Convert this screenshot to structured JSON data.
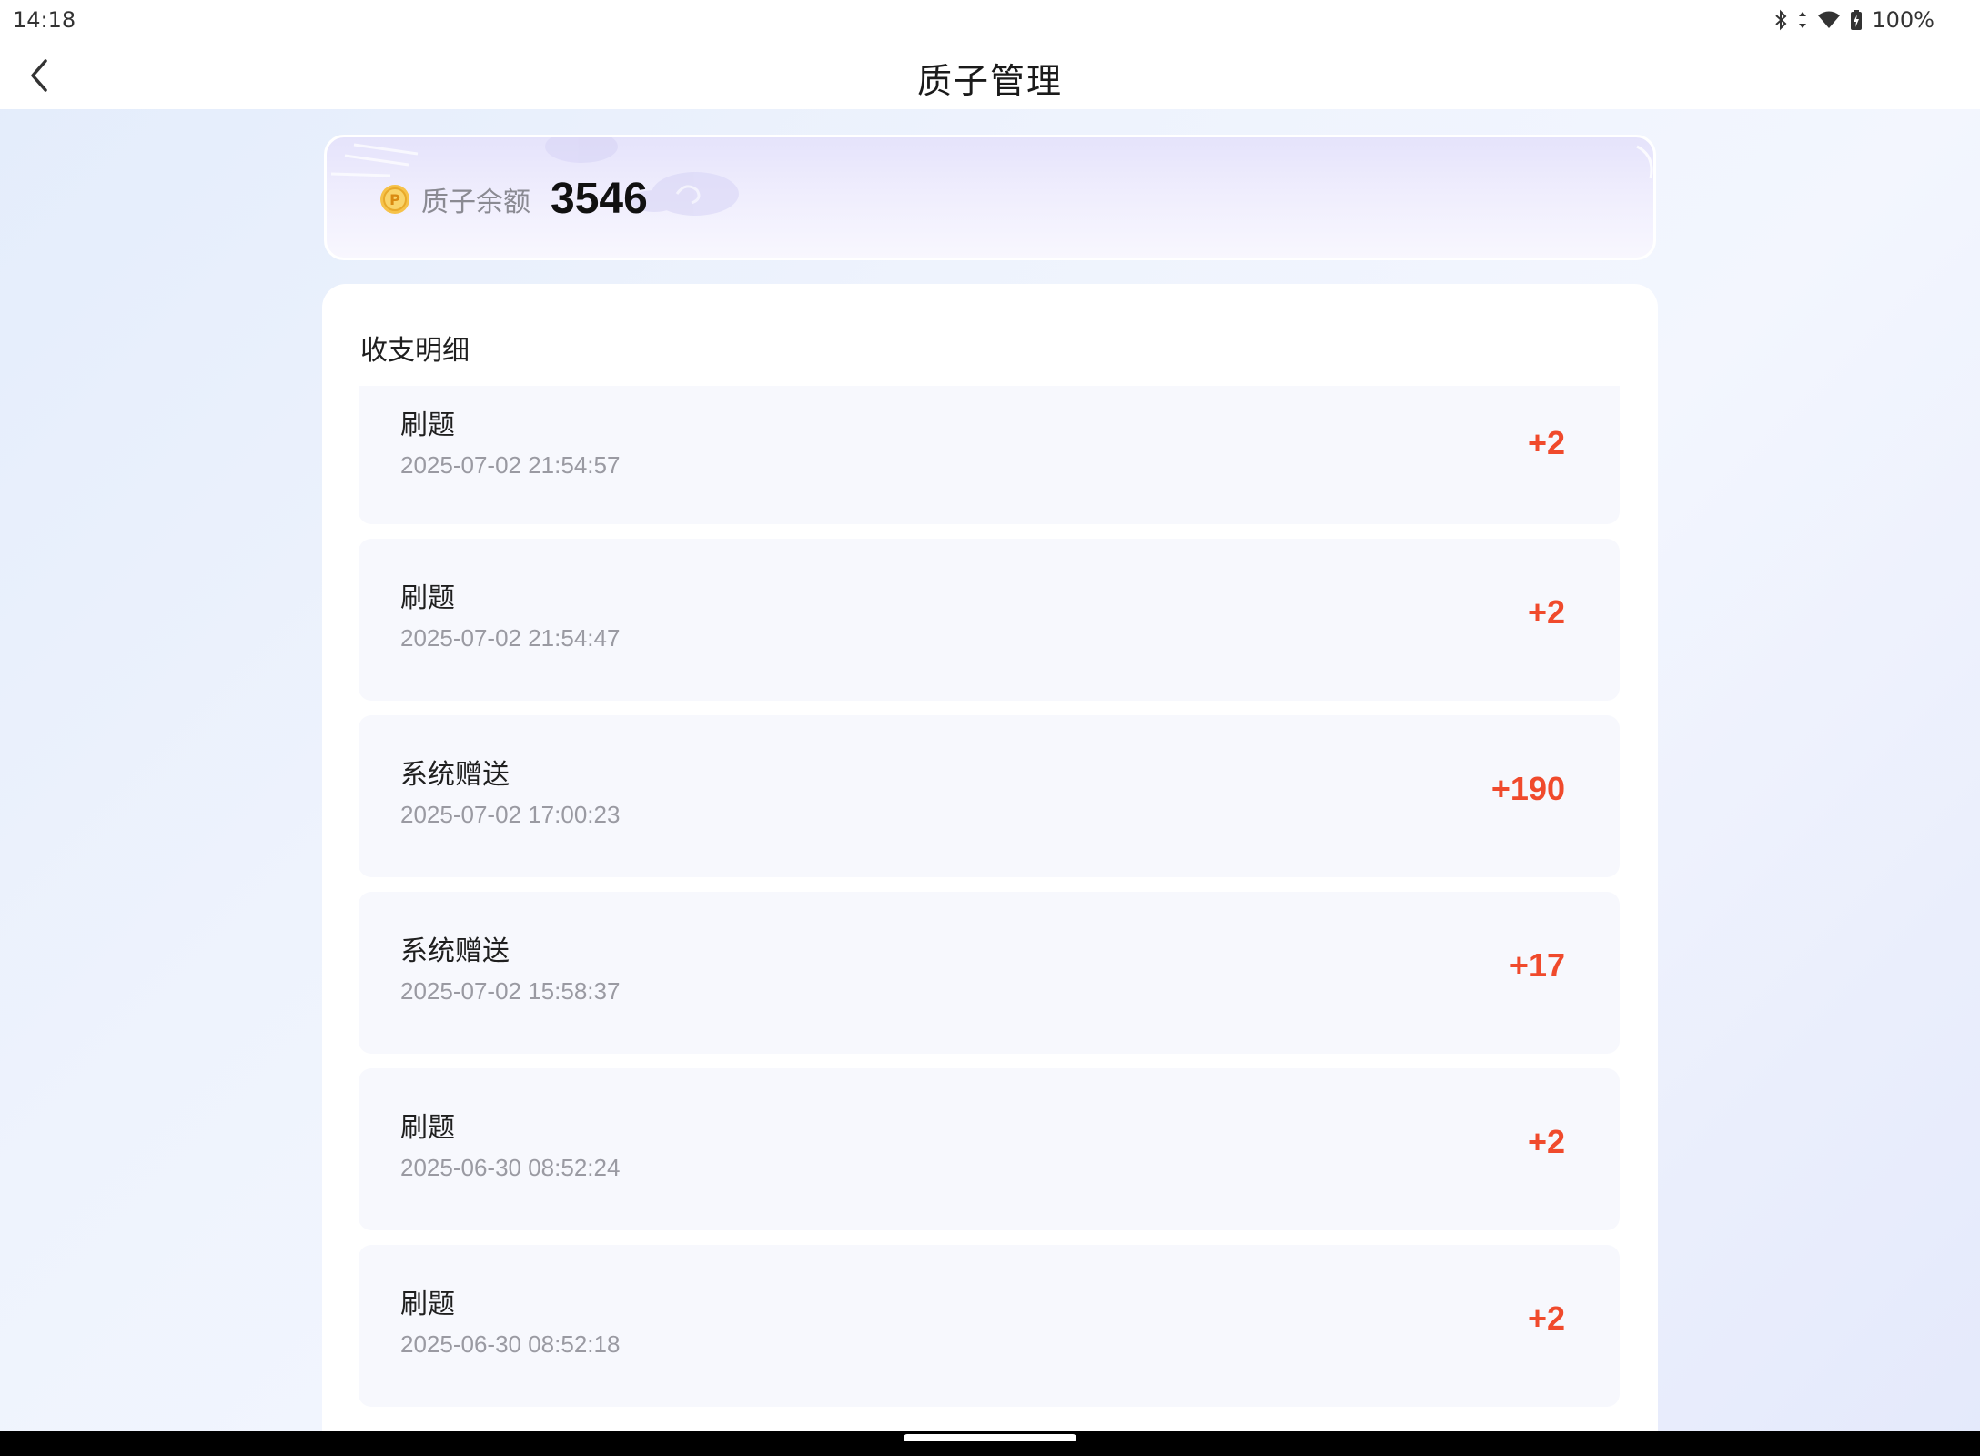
{
  "status_bar": {
    "time": "14:18",
    "battery": "100%",
    "icons": [
      "bluetooth-icon",
      "data-arrows-icon",
      "wifi-icon",
      "battery-icon"
    ]
  },
  "nav": {
    "title": "质子管理",
    "back_icon": "chevron-left-icon"
  },
  "balance": {
    "label": "质子余额",
    "value": "3546",
    "icon": "coin-icon"
  },
  "details": {
    "title": "收支明细",
    "records": [
      {
        "name": "刷题",
        "time": "2025-07-02 21:54:57",
        "amount": "+2"
      },
      {
        "name": "刷题",
        "time": "2025-07-02 21:54:47",
        "amount": "+2"
      },
      {
        "name": "系统赠送",
        "time": "2025-07-02 17:00:23",
        "amount": "+190"
      },
      {
        "name": "系统赠送",
        "time": "2025-07-02 15:58:37",
        "amount": "+17"
      },
      {
        "name": "刷题",
        "time": "2025-06-30 08:52:24",
        "amount": "+2"
      },
      {
        "name": "刷题",
        "time": "2025-06-30 08:52:18",
        "amount": "+2"
      }
    ]
  },
  "colors": {
    "accent_amount": "#f04a2c",
    "card_bg": "#f7f8fd",
    "secondary_text": "#9a9aa2"
  }
}
